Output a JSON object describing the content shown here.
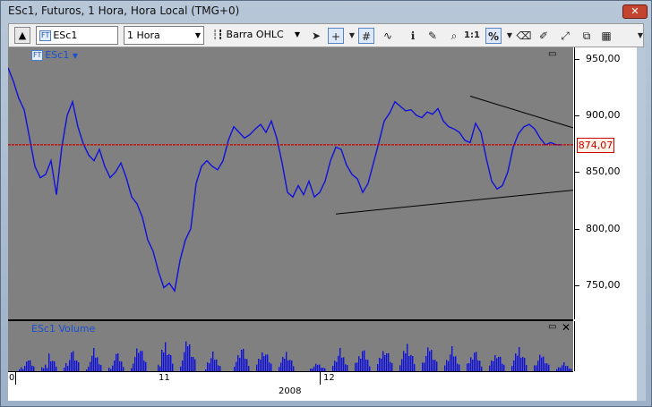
{
  "window": {
    "title": "ESc1, Futuros, 1 Hora, Hora Local (TMG+0)",
    "close_icon": "close-icon"
  },
  "toolbar": {
    "symbol": "ESc1",
    "symbol_badge": "FT",
    "interval": "1 Hora",
    "chart_type": "Barra OHLC",
    "zoom_label": "1:1",
    "percent_label": "%",
    "tools": [
      "cursor-arrow-icon",
      "crosshair-icon",
      "grid-toggle-icon",
      "indicator-icon",
      "info-icon",
      "annotation-icon",
      "zoom-icon",
      "one-to-one-icon",
      "percent-icon",
      "eraser-icon",
      "draw-tools-icon",
      "measure-icon",
      "cascade-icon",
      "layout-icon"
    ]
  },
  "chart": {
    "legend": "ESc1",
    "legend_badge": "FT",
    "current_price": "874,07",
    "volume_legend": "ESc1 Volume",
    "year": "2008",
    "x_ticks": [
      "0",
      "11",
      "12"
    ]
  },
  "chart_data": {
    "type": "line",
    "title": "",
    "series": [
      {
        "name": "ESc1",
        "color": "#1010dd",
        "x": [
          0,
          6,
          12,
          18,
          24,
          30,
          36,
          42,
          48,
          54,
          60,
          66,
          72,
          78,
          84,
          90,
          96,
          102,
          108,
          114,
          120,
          126,
          132,
          138,
          144,
          150,
          156,
          162,
          168,
          174,
          180,
          186,
          192,
          198,
          204,
          210,
          216,
          222,
          228,
          234,
          240,
          246,
          252,
          258,
          264,
          270,
          276,
          282,
          288,
          294,
          300,
          306,
          312,
          318,
          324,
          330,
          336,
          342,
          348,
          354,
          360,
          366,
          372,
          378,
          384,
          390,
          396,
          402,
          408,
          414,
          420,
          426,
          432,
          438,
          444,
          450,
          456,
          462,
          468,
          474,
          480,
          486,
          492,
          498,
          504,
          510,
          516,
          522,
          528,
          534,
          540,
          546,
          552,
          558,
          564,
          570,
          576,
          582,
          588,
          594,
          600,
          606,
          612,
          618
        ],
        "y": [
          942,
          930,
          915,
          905,
          880,
          855,
          845,
          848,
          860,
          830,
          872,
          900,
          912,
          890,
          875,
          865,
          860,
          870,
          855,
          845,
          850,
          858,
          845,
          828,
          822,
          810,
          790,
          780,
          762,
          748,
          752,
          745,
          772,
          790,
          800,
          840,
          855,
          860,
          855,
          852,
          860,
          878,
          890,
          885,
          880,
          883,
          888,
          892,
          885,
          895,
          880,
          858,
          832,
          828,
          838,
          830,
          842,
          828,
          832,
          842,
          860,
          872,
          870,
          856,
          848,
          844,
          832,
          840,
          858,
          876,
          895,
          902,
          912,
          908,
          904,
          905,
          900,
          898,
          903,
          901,
          906,
          895,
          890,
          888,
          885,
          878,
          876,
          893,
          885,
          862,
          842,
          835,
          838,
          850,
          872,
          884,
          890,
          892,
          888,
          880,
          874,
          876,
          874,
          874
        ]
      }
    ],
    "ylabel": "",
    "xlabel": "",
    "yticks": [
      750,
      800,
      850,
      900,
      950
    ],
    "ylim": [
      720,
      960
    ],
    "trendlines": [
      {
        "from": [
          366,
          813
        ],
        "to": [
          631,
          834
        ]
      },
      {
        "from": [
          516,
          917
        ],
        "to": [
          631,
          889
        ]
      }
    ],
    "horizontal_line": {
      "value": 874.07,
      "color": "#cc0000"
    }
  },
  "volume_data": {
    "type": "bar",
    "sessions_x": [
      20,
      45,
      70,
      95,
      120,
      145,
      175,
      200,
      228,
      260,
      285,
      310,
      345,
      370,
      395,
      420,
      445,
      470,
      495,
      520,
      545,
      570,
      595,
      620
    ],
    "values": [
      18,
      22,
      30,
      26,
      24,
      34,
      36,
      40,
      22,
      30,
      28,
      24,
      10,
      26,
      28,
      30,
      34,
      32,
      28,
      26,
      24,
      30,
      22,
      10
    ]
  },
  "colors": {
    "price": "#1010dd",
    "plot_bg": "#808080",
    "current_line": "#cc0000",
    "trend": "#000000"
  }
}
